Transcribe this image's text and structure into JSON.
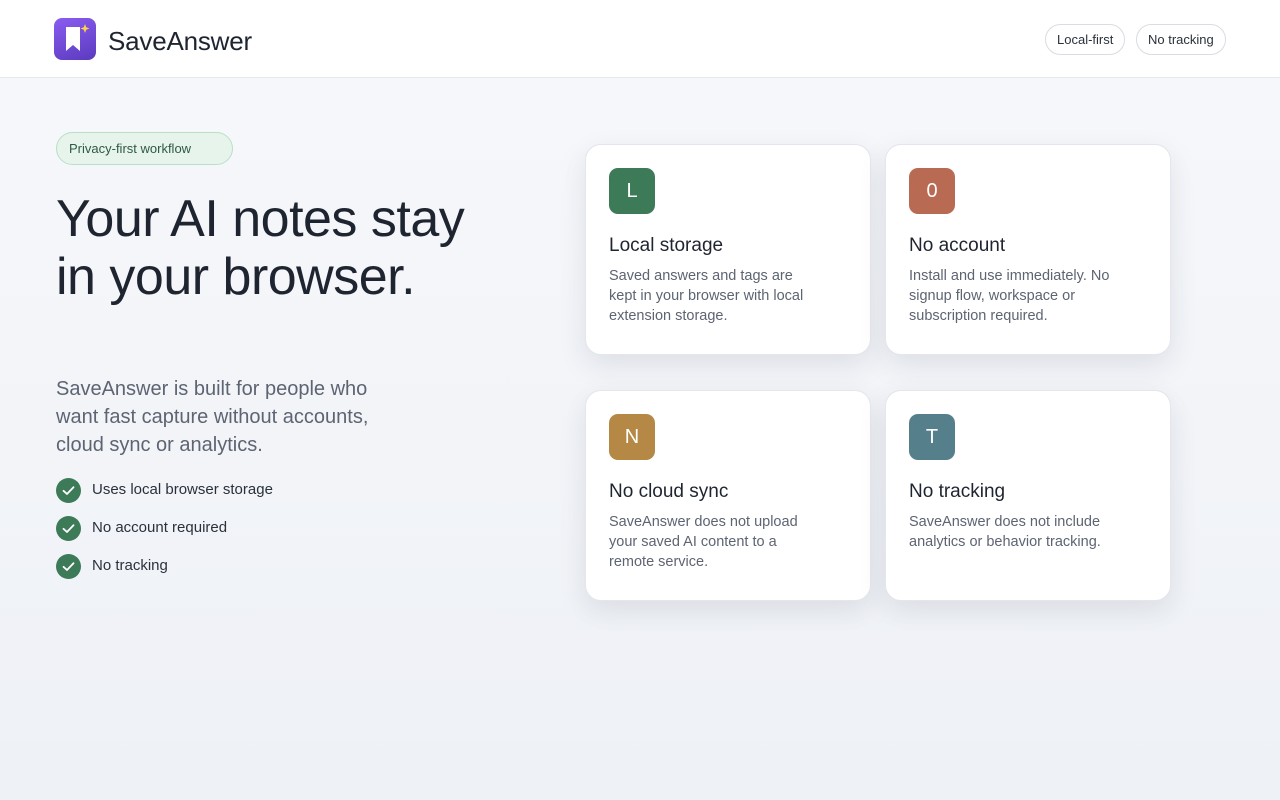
{
  "app": {
    "brand": "SaveAnswer"
  },
  "header": {
    "pills": [
      "Local-first",
      "No tracking"
    ]
  },
  "hero": {
    "badge": "Privacy-first workflow",
    "headline": "Your AI notes stay in your browser.",
    "subline": "SaveAnswer is built for people who want fast capture without accounts, cloud sync or analytics.",
    "checks": [
      "Uses local browser storage",
      "No account required",
      "No tracking"
    ]
  },
  "cards": [
    {
      "icon_letter": "L",
      "color": "#3c7a58",
      "title": "Local storage",
      "desc": "Saved answers and tags are kept in your browser with local extension storage."
    },
    {
      "icon_letter": "0",
      "color": "#b96a52",
      "title": "No account",
      "desc": "Install and use immediately. No signup flow, workspace or subscription required."
    },
    {
      "icon_letter": "N",
      "color": "#b58845",
      "title": "No cloud sync",
      "desc": "SaveAnswer does not upload your saved AI content to a remote service."
    },
    {
      "icon_letter": "T",
      "color": "#567f8c",
      "title": "No tracking",
      "desc": "SaveAnswer does not include analytics or behavior tracking."
    }
  ],
  "colors": {
    "accent": "#3c7a58",
    "logo": "#6a47d6"
  },
  "icons": {
    "logo": "bookmark-sparkle-icon",
    "check": "check-icon"
  }
}
